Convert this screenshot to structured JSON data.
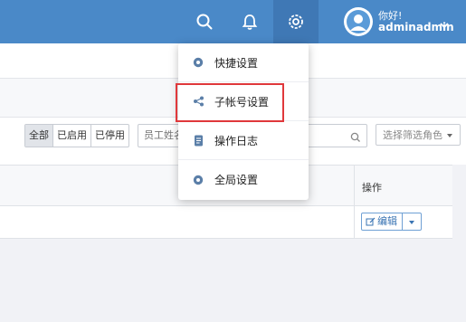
{
  "colors": {
    "header": "#4a89c8",
    "accent": "#3a74b3",
    "highlight": "#e0383b"
  },
  "header": {
    "icons": [
      "search-icon",
      "bell-icon",
      "gear-icon"
    ],
    "greeting": "你好!",
    "username": "adminadmin"
  },
  "filters": {
    "status_buttons": [
      "全部",
      "已启用",
      "已停用"
    ],
    "selected_status": "全部",
    "search_placeholder": "员工姓名",
    "role_select": "选择筛选角色"
  },
  "table": {
    "columns": [
      "操作"
    ],
    "rows": [
      {
        "action_label": "编辑"
      }
    ]
  },
  "settings_menu": {
    "items": [
      {
        "label": "快捷设置",
        "icon": "gear-icon"
      },
      {
        "label": "子帐号设置",
        "icon": "share-icon"
      },
      {
        "label": "操作日志",
        "icon": "document-icon"
      },
      {
        "label": "全局设置",
        "icon": "gear-icon"
      }
    ],
    "highlighted_item": "子帐号设置"
  }
}
